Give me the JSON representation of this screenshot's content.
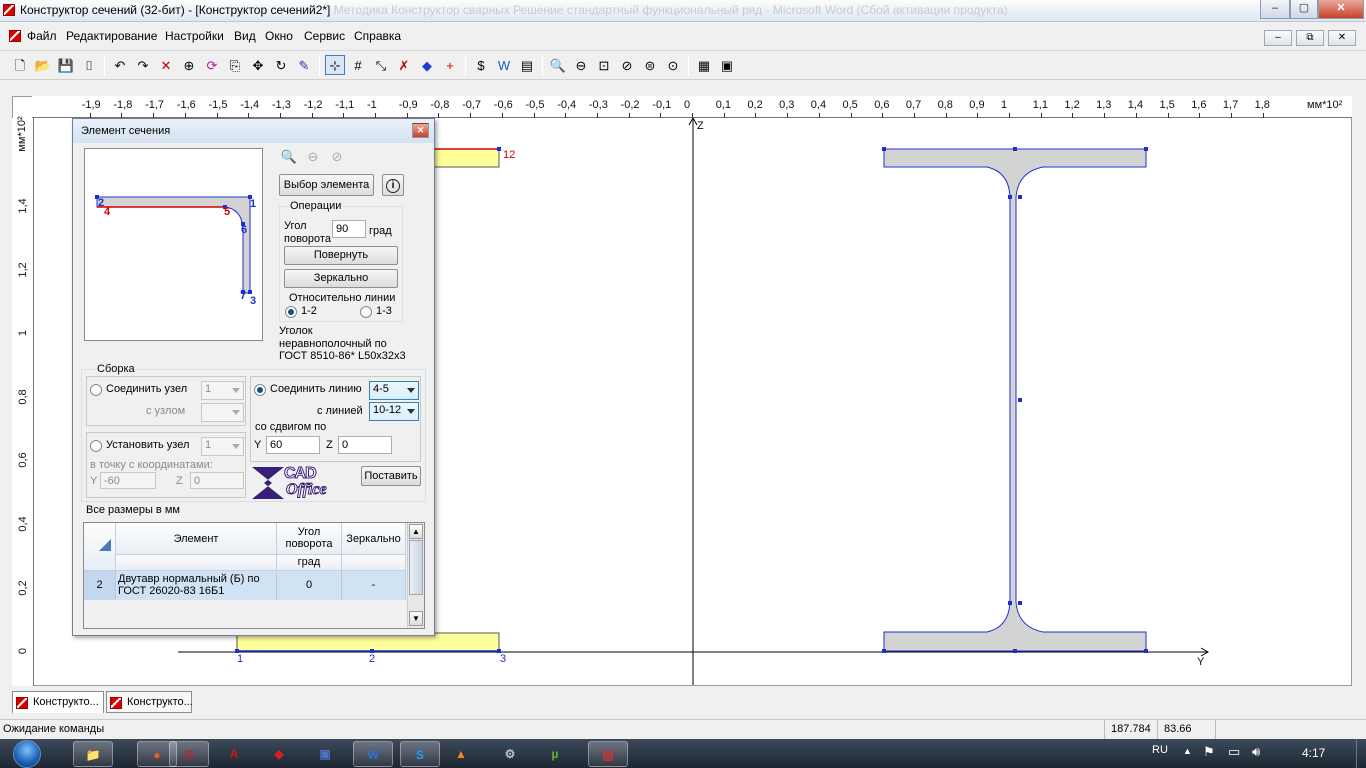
{
  "window": {
    "title": "Конструктор сечений (32-бит) - [Конструктор сечений2*]",
    "title_faded": "Методика Конструктор сварных Решение стандартный функциональный ряд - Microsoft Word (Сбой активации продукта)",
    "minimize": "–",
    "maximize": "▢",
    "close": "✕"
  },
  "menu": {
    "items": [
      "Файл",
      "Редактирование",
      "Настройки",
      "Вид",
      "Окно",
      "Сервис",
      "Справка"
    ],
    "mdi_minimize": "–",
    "mdi_restore": "⧉",
    "mdi_close": "✕"
  },
  "toolbar": {
    "groups": [
      [
        "new-doc-icon",
        "open-folder-icon",
        "save-icon",
        "page-setup-icon"
      ],
      [
        "undo-icon",
        "redo-icon",
        "delete-icon",
        "move-node-icon",
        "rotate-icon",
        "copy-icon",
        "move-icon",
        "refresh-icon",
        "eraser-icon"
      ],
      [
        "grid-snap-icon",
        "grid-icon",
        "dimension-icon",
        "cross-icon",
        "diamond-icon",
        "plus-icon"
      ],
      [
        "dollar-icon",
        "w-icon",
        "color-bars-icon"
      ],
      [
        "zoom-in-icon",
        "zoom-out-icon",
        "zoom-window-icon",
        "zoom-prev-icon",
        "zoom-all-icon",
        "zoom-fit-icon"
      ],
      [
        "report-icon",
        "calc-icon"
      ]
    ],
    "glyphs": {
      "new-doc-icon": "🗋",
      "open-folder-icon": "📂",
      "save-icon": "💾",
      "page-setup-icon": "⌷",
      "undo-icon": "↶",
      "redo-icon": "↷",
      "delete-icon": "✕",
      "move-node-icon": "⊕",
      "rotate-icon": "⟳",
      "copy-icon": "⎘",
      "move-icon": "✥",
      "refresh-icon": "↻",
      "eraser-icon": "✎",
      "grid-snap-icon": "⊹",
      "grid-icon": "#",
      "dimension-icon": "⤡",
      "cross-icon": "✗",
      "diamond-icon": "◆",
      "plus-icon": "+",
      "dollar-icon": "$",
      "w-icon": "W",
      "color-bars-icon": "▤",
      "zoom-in-icon": "🔍",
      "zoom-out-icon": "⊖",
      "zoom-window-icon": "⊡",
      "zoom-prev-icon": "⊘",
      "zoom-all-icon": "⊜",
      "zoom-fit-icon": "⊙",
      "report-icon": "▦",
      "calc-icon": "▣"
    },
    "colors": {
      "delete-icon": "#c00000",
      "diamond-icon": "#1d3fd0",
      "plus-icon": "#e00000",
      "w-icon": "#1e5cc8",
      "cross-icon": "#c00000",
      "eraser-icon": "#1a39b5",
      "rotate-icon": "#c0139b"
    }
  },
  "ruler": {
    "h_labels": [
      "-1,9",
      "-1,8",
      "-1,7",
      "-1,6",
      "-1,5",
      "-1,4",
      "-1,3",
      "-1,2",
      "-1,1",
      "-1",
      "-0,9",
      "-0,8",
      "-0,7",
      "-0,6",
      "-0,5",
      "-0,4",
      "-0,3",
      "-0,2",
      "-0,1",
      "0",
      "0,1",
      "0,2",
      "0,3",
      "0,4",
      "0,5",
      "0,6",
      "0,7",
      "0,8",
      "0,9",
      "1",
      "1,1",
      "1,2",
      "1,3",
      "1,4",
      "1,5",
      "1,6",
      "1,7",
      "1,8"
    ],
    "h_unit": "мм*10²",
    "v_labels": [
      "1,4",
      "1,2",
      "1",
      "0,8",
      "0,6",
      "0,4",
      "0,2",
      "0"
    ],
    "v_unit": "мм*10²"
  },
  "canvas": {
    "axis_z": "Z",
    "axis_y": "Y",
    "angle_labels": [
      "12",
      "1",
      "2",
      "3"
    ]
  },
  "dialog": {
    "title": "Элемент сечения",
    "close": "✕",
    "preview_labels": [
      "2",
      "4",
      "5",
      "1",
      "6",
      "7",
      "3"
    ],
    "select_element": "Выбор элемента",
    "info_icon": "i",
    "operations_title": "Операции",
    "rotation_angle_label_1": "Угол",
    "rotation_angle_label_2": "поворота",
    "rotation_angle_value": "90",
    "rotation_unit": "град",
    "rotate_button": "Повернуть",
    "mirror_button": "Зеркально",
    "relative_line": "Относительно линии",
    "line_12": "1-2",
    "line_13": "1-3",
    "element_desc_1": "Уголок",
    "element_desc_2": "неравнополочный по",
    "element_desc_3": "ГОСТ 8510-86* L50x32x3",
    "assembly_title": "Сборка",
    "connect_node": "Соединить узел",
    "connect_node_value": "1",
    "with_node": "с узлом",
    "with_node_value": "",
    "set_node": "Установить узел",
    "set_node_value": "1",
    "to_point_coords": "в точку с координатами:",
    "y_label": "Y",
    "y_coord_value": "-60",
    "z_label": "Z",
    "z_coord_value": "0",
    "connect_line": "Соединить линию",
    "connect_line_value": "4-5",
    "with_line": "с линией",
    "with_line_value": "10-12",
    "with_offset": "со сдвигом по",
    "offset_y_label": "Y",
    "offset_y_value": "60",
    "offset_z_label": "Z",
    "offset_z_value": "0",
    "logo_top": "CAD",
    "logo_bottom": "Office",
    "place_button": "Поставить",
    "all_sizes": "Все размеры в мм",
    "table": {
      "col_element": "Элемент",
      "col_angle_1": "Угол",
      "col_angle_2": "поворота",
      "col_mirror": "Зеркально",
      "unit_angle": "град",
      "row": {
        "num": "2",
        "element": "Двутавр нормальный (Б) по ГОСТ 26020-83  16Б1",
        "angle": "0",
        "mirror": "-"
      }
    }
  },
  "mdi_tabs": [
    "Конструкто...",
    "Конструкто..."
  ],
  "status": {
    "message": "Ожидание команды",
    "coord_1": "187.784",
    "coord_2": "83.66"
  },
  "taskbar": {
    "apps": [
      "explorer-icon",
      "firefox-icon",
      "opera-icon",
      "acrobat-icon",
      "scad-icon",
      "archive-icon",
      "word-icon",
      "skype-icon",
      "avast-icon",
      "tool-icon",
      "utorrent-icon",
      "konstruktor-icon"
    ],
    "app_glyphs": {
      "explorer-icon": "📁",
      "firefox-icon": "●",
      "opera-icon": "O",
      "acrobat-icon": "A",
      "scad-icon": "◆",
      "archive-icon": "▣",
      "word-icon": "W",
      "skype-icon": "S",
      "avast-icon": "▲",
      "tool-icon": "⚙",
      "utorrent-icon": "µ",
      "konstruktor-icon": "▤"
    },
    "app_colors": {
      "explorer-icon": "#e8c35a",
      "firefox-icon": "#e8621c",
      "opera-icon": "#d21b1b",
      "acrobat-icon": "#c71a1a",
      "scad-icon": "#d62020",
      "archive-icon": "#4a74c9",
      "word-icon": "#2f6fd6",
      "skype-icon": "#1da1f2",
      "avast-icon": "#f48a1f",
      "tool-icon": "#b7c2cc",
      "utorrent-icon": "#5fb531",
      "konstruktor-icon": "#d03030"
    },
    "lang": "RU",
    "time": "4:17"
  },
  "colors": {
    "section_fill": "#d3d3d3",
    "section_stroke": "#1c2fd0",
    "angle_fill": "#ffff99",
    "angle_stroke": "#d40000",
    "node_label": "#1c2fd0"
  }
}
